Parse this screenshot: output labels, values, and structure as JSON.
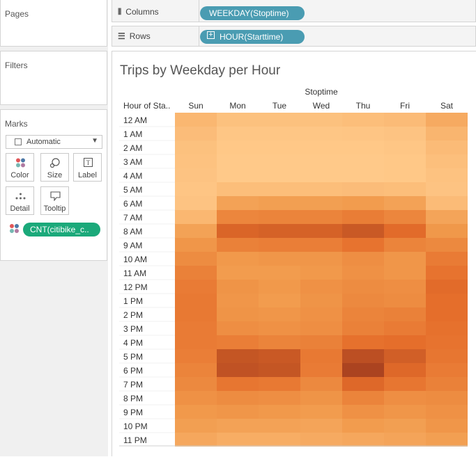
{
  "panels": {
    "pages_title": "Pages",
    "filters_title": "Filters",
    "marks_title": "Marks",
    "mark_type": "Automatic",
    "mark_buttons": [
      "Color",
      "Size",
      "Label",
      "Detail",
      "Tooltip"
    ],
    "color_field": "CNT(citibike_c.."
  },
  "shelves": {
    "columns_label": "Columns",
    "columns_pill": "WEEKDAY(Stoptime)",
    "rows_label": "Rows",
    "rows_pill": "HOUR(Starttime)",
    "pill_color": "#4a9cb2",
    "marks_pill_color": "#1ba97a"
  },
  "chart_data": {
    "type": "heatmap",
    "title": "Trips by Weekday per Hour",
    "column_header": "Stoptime",
    "row_header": "Hour of Sta..",
    "columns": [
      "Sun",
      "Mon",
      "Tue",
      "Wed",
      "Thu",
      "Fri",
      "Sat"
    ],
    "rows": [
      "12 AM",
      "1 AM",
      "2 AM",
      "3 AM",
      "4 AM",
      "5 AM",
      "6 AM",
      "7 AM",
      "8 AM",
      "9 AM",
      "10 AM",
      "11 AM",
      "12 PM",
      "1 PM",
      "2 PM",
      "3 PM",
      "4 PM",
      "5 PM",
      "6 PM",
      "7 PM",
      "8 PM",
      "9 PM",
      "10 PM",
      "11 PM"
    ],
    "color_range": [
      "#ffc989",
      "#9e3a1e"
    ],
    "relative_intensity": [
      [
        0.13,
        0.06,
        0.06,
        0.06,
        0.08,
        0.1,
        0.22
      ],
      [
        0.09,
        0.02,
        0.02,
        0.02,
        0.03,
        0.04,
        0.14
      ],
      [
        0.06,
        0.01,
        0.01,
        0.01,
        0.01,
        0.02,
        0.1
      ],
      [
        0.05,
        0.0,
        0.0,
        0.0,
        0.0,
        0.01,
        0.07
      ],
      [
        0.04,
        0.0,
        0.0,
        0.0,
        0.0,
        0.01,
        0.05
      ],
      [
        0.03,
        0.08,
        0.08,
        0.08,
        0.09,
        0.08,
        0.04
      ],
      [
        0.04,
        0.28,
        0.3,
        0.3,
        0.32,
        0.28,
        0.1
      ],
      [
        0.13,
        0.48,
        0.5,
        0.5,
        0.55,
        0.48,
        0.26
      ],
      [
        0.28,
        0.72,
        0.74,
        0.74,
        0.8,
        0.68,
        0.35
      ],
      [
        0.36,
        0.52,
        0.54,
        0.54,
        0.62,
        0.5,
        0.46
      ],
      [
        0.44,
        0.34,
        0.36,
        0.36,
        0.42,
        0.36,
        0.56
      ],
      [
        0.52,
        0.32,
        0.32,
        0.34,
        0.4,
        0.36,
        0.62
      ],
      [
        0.56,
        0.38,
        0.34,
        0.4,
        0.44,
        0.42,
        0.68
      ],
      [
        0.58,
        0.36,
        0.32,
        0.38,
        0.46,
        0.44,
        0.66
      ],
      [
        0.58,
        0.38,
        0.36,
        0.4,
        0.5,
        0.52,
        0.66
      ],
      [
        0.56,
        0.42,
        0.4,
        0.42,
        0.52,
        0.56,
        0.64
      ],
      [
        0.56,
        0.54,
        0.5,
        0.52,
        0.64,
        0.66,
        0.62
      ],
      [
        0.54,
        0.82,
        0.8,
        0.58,
        0.86,
        0.76,
        0.6
      ],
      [
        0.5,
        0.84,
        0.82,
        0.56,
        0.94,
        0.7,
        0.56
      ],
      [
        0.46,
        0.6,
        0.58,
        0.46,
        0.7,
        0.6,
        0.52
      ],
      [
        0.4,
        0.44,
        0.42,
        0.38,
        0.5,
        0.42,
        0.44
      ],
      [
        0.34,
        0.36,
        0.34,
        0.32,
        0.4,
        0.36,
        0.4
      ],
      [
        0.3,
        0.28,
        0.28,
        0.26,
        0.32,
        0.3,
        0.36
      ],
      [
        0.24,
        0.2,
        0.2,
        0.22,
        0.24,
        0.26,
        0.3
      ]
    ]
  }
}
